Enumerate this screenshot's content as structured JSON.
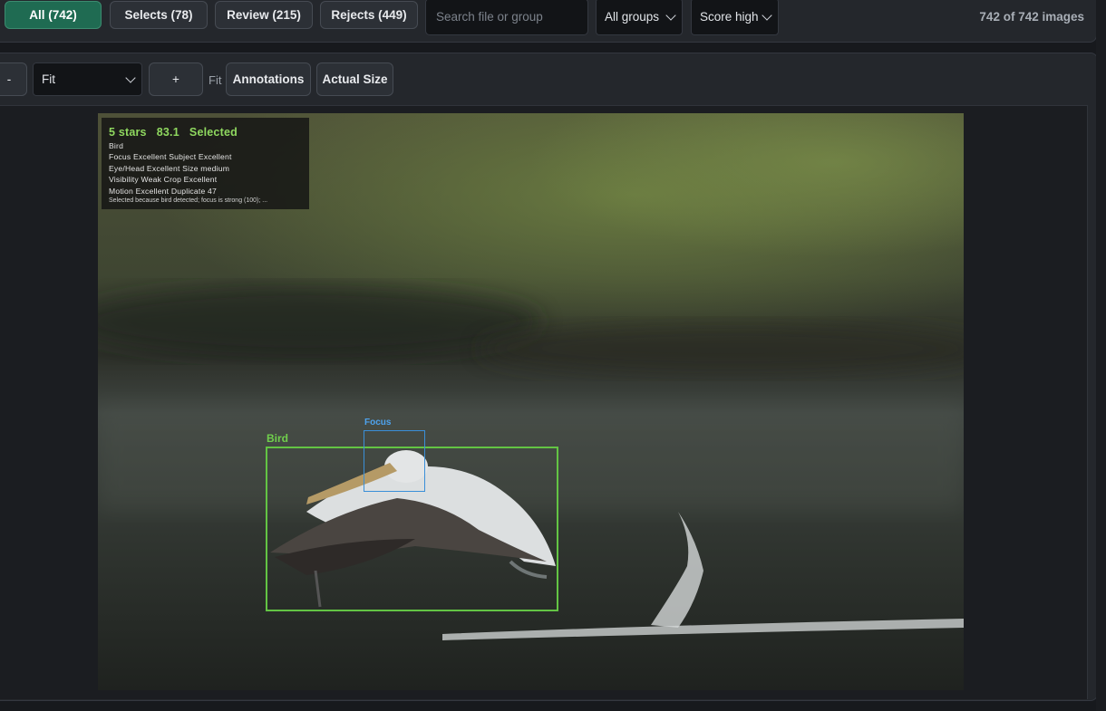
{
  "filters": {
    "tabs": [
      {
        "label": "All (742)",
        "active": true
      },
      {
        "label": "Selects (78)",
        "active": false
      },
      {
        "label": "Review (215)",
        "active": false
      },
      {
        "label": "Rejects (449)",
        "active": false
      }
    ],
    "search_placeholder": "Search file or group",
    "group_select": "All groups",
    "sort_select": "Score high",
    "count": "742 of 742 images"
  },
  "viewer_toolbar": {
    "minus_label": "-",
    "zoom_select": "Fit",
    "plus_label": "+",
    "zoom_state": "Fit",
    "annotations_label": "Annotations",
    "actual_size_label": "Actual Size"
  },
  "image": {
    "summary": {
      "stars": "5 stars",
      "score": "83.1",
      "status": "Selected",
      "subject": "Bird",
      "line_focus": "Focus Excellent  Subject Excellent",
      "line_eye": "Eye/Head Excellent  Size medium",
      "line_visibility": "Visibility Weak  Crop Excellent",
      "line_motion": "Motion Excellent  Duplicate 47",
      "reason": "Selected because bird detected; focus is strong (100); ..."
    },
    "boxes": {
      "bird_label": "Bird",
      "focus_label": "Focus"
    },
    "colors": {
      "bird_box": "#63c444",
      "focus_box": "#3a8fd8"
    }
  },
  "colors": {
    "accent": "#1f6b52",
    "background": "#17191d"
  }
}
